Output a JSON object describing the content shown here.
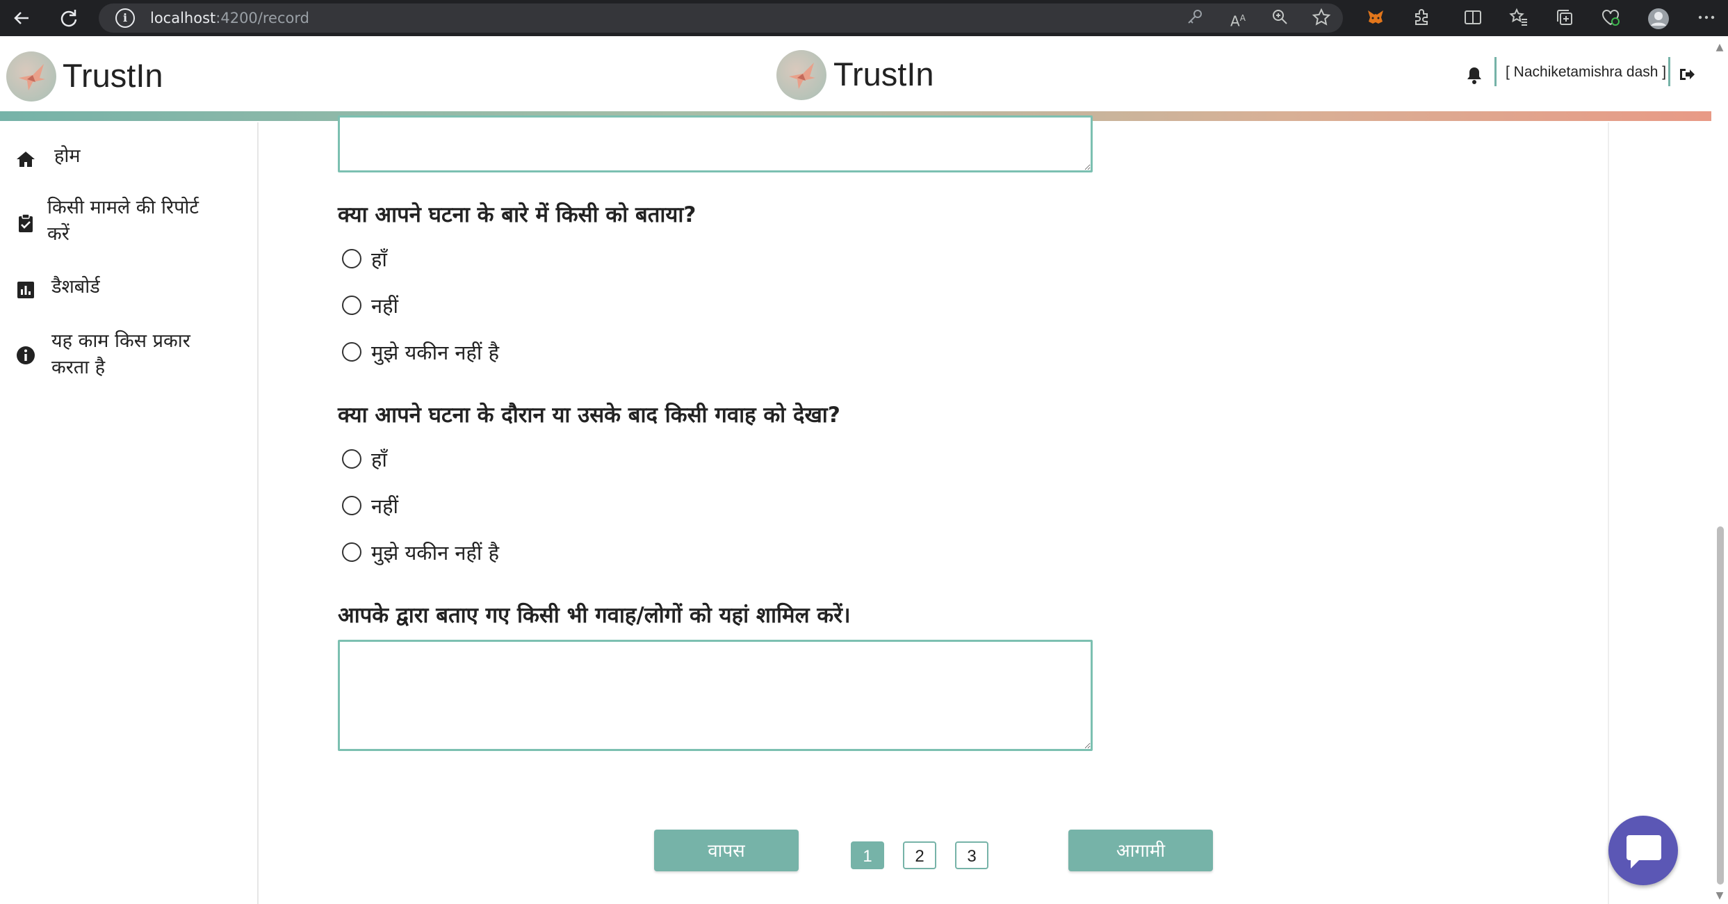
{
  "browser": {
    "url_host": "localhost",
    "url_path": ":4200/record"
  },
  "header": {
    "brand_left": "TrustIn",
    "brand_center": "TrustIn",
    "username": "[ Nachiketamishra dash ]"
  },
  "sidebar": {
    "items": [
      {
        "label_line1": "होम",
        "label_line2": "",
        "icon": "home-icon"
      },
      {
        "label_line1": "किसी मामले की रिपोर्ट",
        "label_line2": "करें",
        "icon": "clipboard-check-icon"
      },
      {
        "label_line1": "डैशबोर्ड",
        "label_line2": "",
        "icon": "bar-chart-icon"
      },
      {
        "label_line1": "यह काम किस प्रकार",
        "label_line2": "करता है",
        "icon": "info-icon"
      }
    ]
  },
  "form": {
    "questions": [
      {
        "text": "क्या आपने घटना के बारे में किसी को बताया?",
        "options": [
          "हाँ",
          "नहीं",
          "मुझे यकीन नहीं है"
        ]
      },
      {
        "text": "क्या आपने घटना के दौरान या उसके बाद किसी गवाह को देखा?",
        "options": [
          "हाँ",
          "नहीं",
          "मुझे यकीन नहीं है"
        ]
      },
      {
        "text": "आपके द्वारा बताए गए किसी भी गवाह/लोगों को यहां शामिल करें।"
      }
    ]
  },
  "pagination": {
    "back_label": "वापस",
    "next_label": "आगामी",
    "pages": [
      "1",
      "2",
      "3"
    ],
    "current_page": 1
  },
  "colors": {
    "accent": "#76b3a8",
    "chat": "#5b57b5"
  }
}
